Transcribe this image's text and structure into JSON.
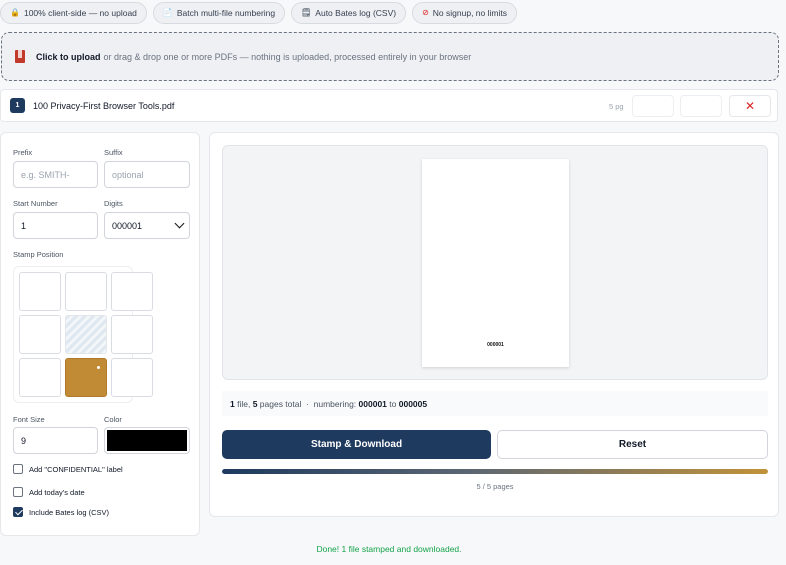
{
  "badges": [
    {
      "icon": "lock-icon",
      "label": "100% client-side — no upload"
    },
    {
      "icon": "document-icon",
      "label": "Batch multi-file numbering"
    },
    {
      "icon": "log-icon",
      "label": "Auto Bates log (CSV)"
    },
    {
      "icon": "no-icon",
      "label": "No signup, no limits"
    }
  ],
  "dropzone": {
    "strong": "Click to upload",
    "rest": "or drag & drop one or more PDFs — nothing is uploaded, processed entirely in your browser"
  },
  "file": {
    "index": "1",
    "name": "100 Privacy-First Browser Tools.pdf",
    "pages": "5 pg",
    "remove": "✕"
  },
  "settings": {
    "prefix_label": "Prefix",
    "prefix_placeholder": "e.g. SMITH-",
    "suffix_label": "Suffix",
    "suffix_placeholder": "optional",
    "start_label": "Start Number",
    "start_value": "1",
    "digits_label": "Digits",
    "digits_value": "000001",
    "position_label": "Stamp Position",
    "position_selected": "bottom-center",
    "font_size_label": "Font Size",
    "font_size_value": "9",
    "color_label": "Color",
    "color_value": "#000000",
    "checkboxes": [
      {
        "label": "Add \"CONFIDENTIAL\" label",
        "checked": false
      },
      {
        "label": "Add today's date",
        "checked": false
      },
      {
        "label": "Include Bates log (CSV)",
        "checked": true
      }
    ]
  },
  "preview": {
    "stamp_text": "000001"
  },
  "summary": {
    "files": "1",
    "files_text": " file, ",
    "pages": "5",
    "pages_text": " pages total  ·  numbering: ",
    "from": "000001",
    "to_text": " to ",
    "to": "000005"
  },
  "actions": {
    "stamp_label": "Stamp & Download",
    "reset_label": "Reset"
  },
  "progress": {
    "percent": 100,
    "label": "5 / 5 pages"
  },
  "status": "Done! 1 file stamped and downloaded.",
  "colors": {
    "primary": "#1e3a5f",
    "accent": "#c18a35",
    "success": "#16a34a",
    "danger": "#dc2626"
  }
}
